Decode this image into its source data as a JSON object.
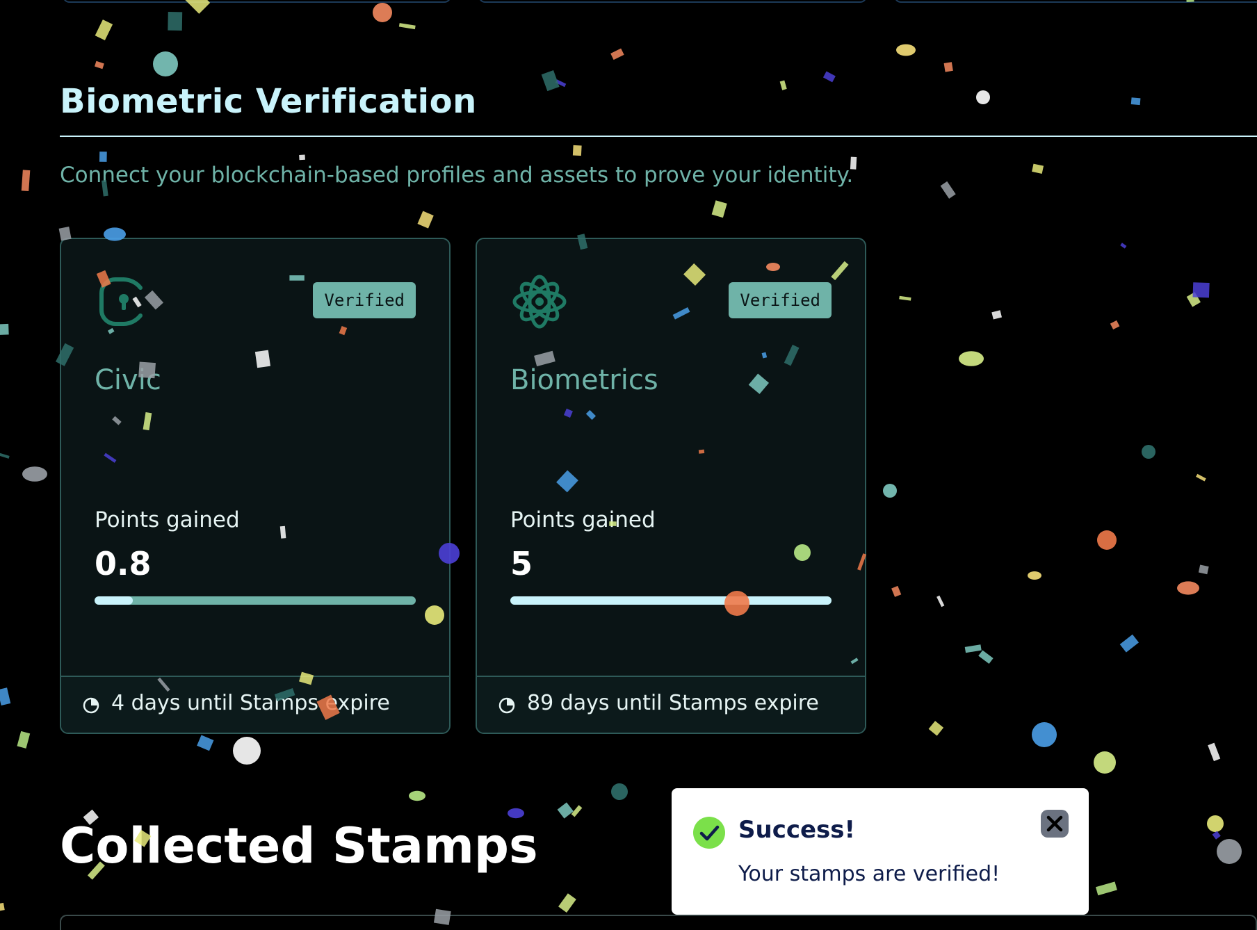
{
  "section": {
    "title": "Biometric Verification",
    "description": "Connect your blockchain-based profiles and assets to prove your identity."
  },
  "stamps": [
    {
      "icon": "civic-logo-icon",
      "badge": "Verified",
      "name": "Civic",
      "points_label": "Points gained",
      "points_value": "0.8",
      "progress_fraction": 0.12,
      "expiry": "4 days until Stamps expire"
    },
    {
      "icon": "biometrics-logo-icon",
      "badge": "Verified",
      "name": "Biometrics",
      "points_label": "Points gained",
      "points_value": "5",
      "progress_fraction": 1.0,
      "expiry": "89 days until Stamps expire"
    }
  ],
  "collected": {
    "title": "Collected Stamps"
  },
  "toast": {
    "title": "Success!",
    "message": "Your stamps are verified!"
  },
  "colors": {
    "accent": "#6fb3a8",
    "heading": "#c9f3fb",
    "background": "#000000",
    "success": "#7be04a"
  }
}
